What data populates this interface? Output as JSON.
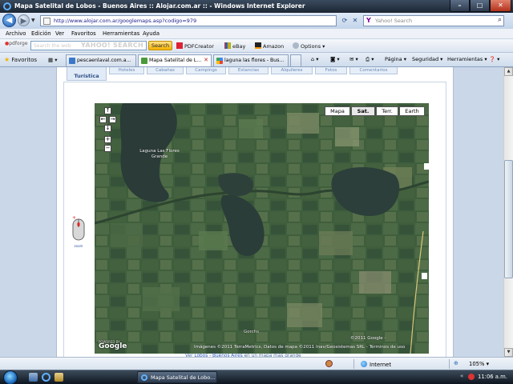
{
  "window": {
    "title": "Mapa Satelital de Lobos - Buenos Aires :: Alojar.com.ar :: - Windows Internet Explorer",
    "min_glyph": "–",
    "max_glyph": "□",
    "close_glyph": "✕"
  },
  "address_bar": {
    "url": "http://www.alojar.com.ar/googlemaps.asp?codigo=979",
    "yahoo_placeholder": "Yahoo! Search"
  },
  "menu": {
    "items": [
      "Archivo",
      "Edición",
      "Ver",
      "Favoritos",
      "Herramientas",
      "Ayuda"
    ]
  },
  "toolbar": {
    "pdforge_label": "pdforge",
    "yahoo_field_hint": "Search the web",
    "yahoo_logo_text": "YAHOO! SEARCH",
    "search_button": "Search",
    "pdfcreator": "PDFCreator",
    "ebay": "eBay",
    "amazon": "Amazon",
    "options": "Options"
  },
  "tabs": {
    "favorites_label": "Favoritos",
    "items": [
      {
        "label": "pescaenlaval.com.a...",
        "active": false
      },
      {
        "label": "Mapa Satelital de L...",
        "active": true
      },
      {
        "label": "laguna las flores - Bus...",
        "active": false
      }
    ],
    "commands": [
      "Página",
      "Seguridad",
      "Herramientas"
    ]
  },
  "page": {
    "active_tab_label": "Turística",
    "other_tabs": [
      "Hoteles",
      "Cabañas",
      "Campings",
      "Estancias",
      "Alquileres",
      "Fotos",
      "Comentarios"
    ],
    "map_types": [
      {
        "label": "Mapa",
        "selected": false
      },
      {
        "label": "Sat.",
        "selected": true
      },
      {
        "label": "Terr.",
        "selected": false
      },
      {
        "label": "Earth",
        "selected": false
      }
    ],
    "map_labels": {
      "laguna": "Laguna Las Flores Grande",
      "gorchs": "Gorchs",
      "year_copy": "©2011 Google -",
      "imagery": "Imágenes ©2011 TerraMetrics, Datos de mapa ©2011 Inav/Geosistemas SRL - Términos de uso",
      "powered": "POWERED BY",
      "google": "Google"
    },
    "below_map": {
      "prefix": "Ver",
      "link1": "Lobos - Buenos Aires",
      "suffix": "en un mapa más grande"
    },
    "mouse_caption": "zoom"
  },
  "statusbar": {
    "zone": "Internet",
    "zoom": "105%"
  },
  "taskbar": {
    "ie_task": "Mapa Satelital de Lobo...",
    "clock": "11:06 a.m."
  }
}
